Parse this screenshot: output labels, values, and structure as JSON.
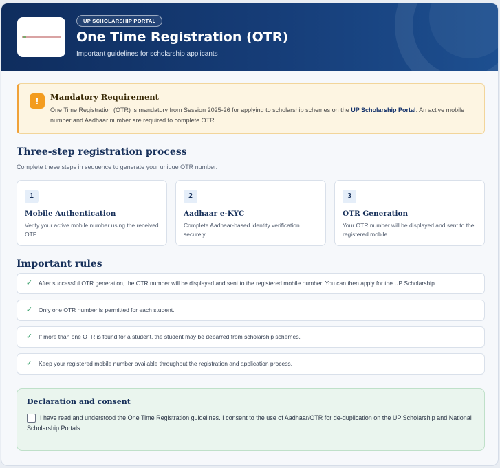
{
  "header": {
    "badge": "UP SCHOLARSHIP PORTAL",
    "title": "One Time Registration (OTR)",
    "subtitle": "Important guidelines for scholarship applicants",
    "logo_icon": "up-portal-logo"
  },
  "alert": {
    "icon": "exclamation-icon",
    "title": "Mandatory Requirement",
    "body_before": "One Time Registration (OTR) is mandatory from Session 2025-26 for applying to scholarship schemes on the ",
    "link_text": "UP Scholarship Portal",
    "body_after": ". An active mobile number and Aadhaar number are required to complete OTR."
  },
  "process": {
    "title": "Three-step registration process",
    "subtitle": "Complete these steps in sequence to generate your unique OTR number.",
    "steps": [
      {
        "num": "1",
        "title": "Mobile Authentication",
        "desc": "Verify your active mobile number using the received OTP."
      },
      {
        "num": "2",
        "title": "Aadhaar e-KYC",
        "desc": "Complete Aadhaar-based identity verification securely."
      },
      {
        "num": "3",
        "title": "OTR Generation",
        "desc": "Your OTR number will be displayed and sent to the registered mobile."
      }
    ]
  },
  "rules": {
    "title": "Important rules",
    "items": [
      "After successful OTR generation, the OTR number will be displayed and sent to the registered mobile number. You can then apply for the UP Scholarship.",
      "Only one OTR number is permitted for each student.",
      "If more than one OTR is found for a student, the student may be debarred from scholarship schemes.",
      "Keep your registered mobile number available throughout the registration and application process."
    ]
  },
  "consent": {
    "title": "Declaration and consent",
    "text": "I have read and understood the One Time Registration guidelines. I consent to the use of Aadhaar/OTR for de-duplication on the UP Scholarship and National Scholarship Portals.",
    "checked": false
  },
  "colors": {
    "header_bg": "#163d78",
    "alert_accent": "#f0a23a",
    "check_green": "#2e9a63",
    "consent_bg": "#eaf5ee"
  }
}
